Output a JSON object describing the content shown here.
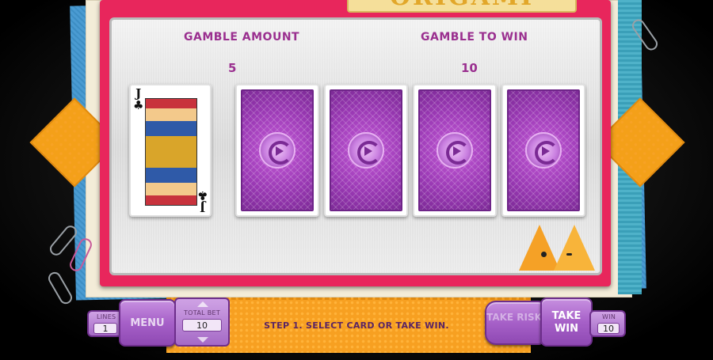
{
  "game": {
    "title": "ORIGAMI"
  },
  "gamble": {
    "amount_label": "GAMBLE AMOUNT",
    "amount_value": "5",
    "to_win_label": "GAMBLE TO WIN",
    "to_win_value": "10"
  },
  "dealer_card": {
    "rank": "J",
    "suit": "♣"
  },
  "hidden_cards": [
    {
      "state": "face-down"
    },
    {
      "state": "face-down"
    },
    {
      "state": "face-down"
    },
    {
      "state": "face-down"
    }
  ],
  "controls": {
    "lines_label": "LINES",
    "lines_value": "1",
    "menu_label": "MENU",
    "total_bet_label": "TOTAL BET",
    "total_bet_value": "10",
    "status_text": "STEP 1. SELECT CARD OR TAKE WIN.",
    "take_risk_label": "TAKE RISK",
    "take_win_label": "TAKE WIN",
    "win_label": "WIN",
    "win_value": "10"
  },
  "colors": {
    "accent_purple": "#9a2f8f",
    "frame_pink": "#e8265c",
    "orange": "#f4a019",
    "card_back": "#9a39b4"
  },
  "icons": [
    "chevron-up-icon",
    "chevron-down-icon",
    "card-back-logo-icon",
    "cat-icon",
    "paper-clip-icon"
  ]
}
